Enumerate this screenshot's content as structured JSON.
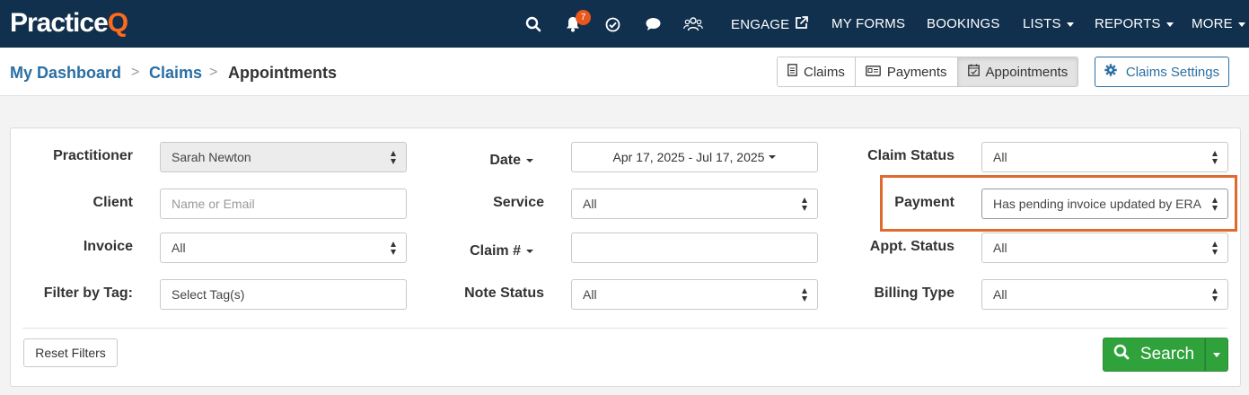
{
  "nav": {
    "logo_main": "Practice",
    "logo_q": "Q",
    "notification_count": "7",
    "links": {
      "engage": "ENGAGE",
      "my_forms": "MY FORMS",
      "bookings": "BOOKINGS",
      "lists": "LISTS",
      "reports": "REPORTS",
      "more": "MORE"
    },
    "icons": [
      "search-icon",
      "bell-icon",
      "check-circle-icon",
      "chat-icon",
      "team-icon",
      "external-link-icon"
    ]
  },
  "breadcrumb": {
    "items": [
      "My Dashboard",
      "Claims",
      "Appointments"
    ],
    "separator": ">"
  },
  "view_tabs": {
    "claims": "Claims",
    "payments": "Payments",
    "appointments": "Appointments",
    "active": "Appointments"
  },
  "claims_settings_label": "Claims Settings",
  "filters": {
    "practitioner": {
      "label": "Practitioner",
      "value": "Sarah Newton"
    },
    "client": {
      "label": "Client",
      "placeholder": "Name or Email"
    },
    "invoice": {
      "label": "Invoice",
      "value": "All"
    },
    "filter_by_tag": {
      "label": "Filter by Tag:",
      "placeholder": "Select Tag(s)"
    },
    "date": {
      "label": "Date",
      "value": "Apr 17, 2025 - Jul 17, 2025"
    },
    "service": {
      "label": "Service",
      "value": "All"
    },
    "claim_number": {
      "label": "Claim #",
      "value": ""
    },
    "note_status": {
      "label": "Note Status",
      "value": "All"
    },
    "claim_status": {
      "label": "Claim Status",
      "value": "All"
    },
    "payment": {
      "label": "Payment",
      "value": "Has pending invoice updated by ERA"
    },
    "appt_status": {
      "label": "Appt. Status",
      "value": "All"
    },
    "billing_type": {
      "label": "Billing Type",
      "value": "All"
    }
  },
  "actions": {
    "reset": "Reset Filters",
    "search": "Search"
  },
  "colors": {
    "nav_bg": "#10304d",
    "logo_accent": "#ff6b1a",
    "link_blue": "#2a6fa3",
    "highlight": "#e06a2d",
    "search_green": "#30a23b"
  }
}
